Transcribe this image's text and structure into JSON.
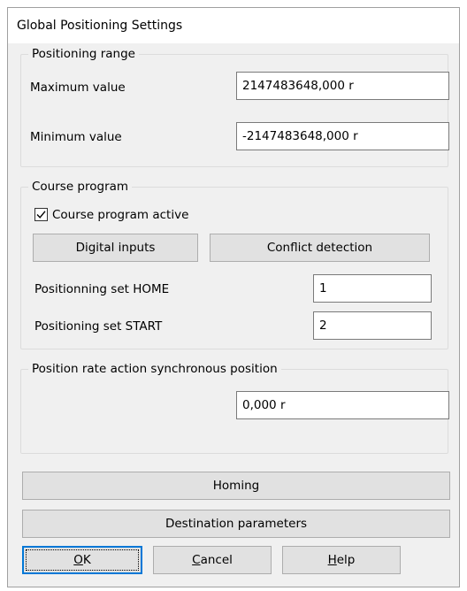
{
  "window": {
    "title": "Global Positioning Settings"
  },
  "positioning_range": {
    "title": "Positioning range",
    "max_label": "Maximum value",
    "max_value": "2147483648,000 r",
    "min_label": "Minimum value",
    "min_value": "-2147483648,000 r"
  },
  "course_program": {
    "title": "Course program",
    "active_label": "Course program active",
    "active_checked": true,
    "digital_inputs_label": "Digital inputs",
    "conflict_detection_label": "Conflict detection",
    "home_label": "Positionning set HOME",
    "home_value": "1",
    "start_label": "Positioning set START",
    "start_value": "2"
  },
  "sync_position": {
    "title": "Position rate action synchronous position",
    "value": "0,000 r"
  },
  "buttons": {
    "homing": "Homing",
    "destination_parameters": "Destination parameters",
    "ok_mnemonic": "O",
    "ok_rest": "K",
    "cancel_mnemonic": "C",
    "cancel_rest": "ancel",
    "help_mnemonic": "H",
    "help_rest": "elp"
  }
}
